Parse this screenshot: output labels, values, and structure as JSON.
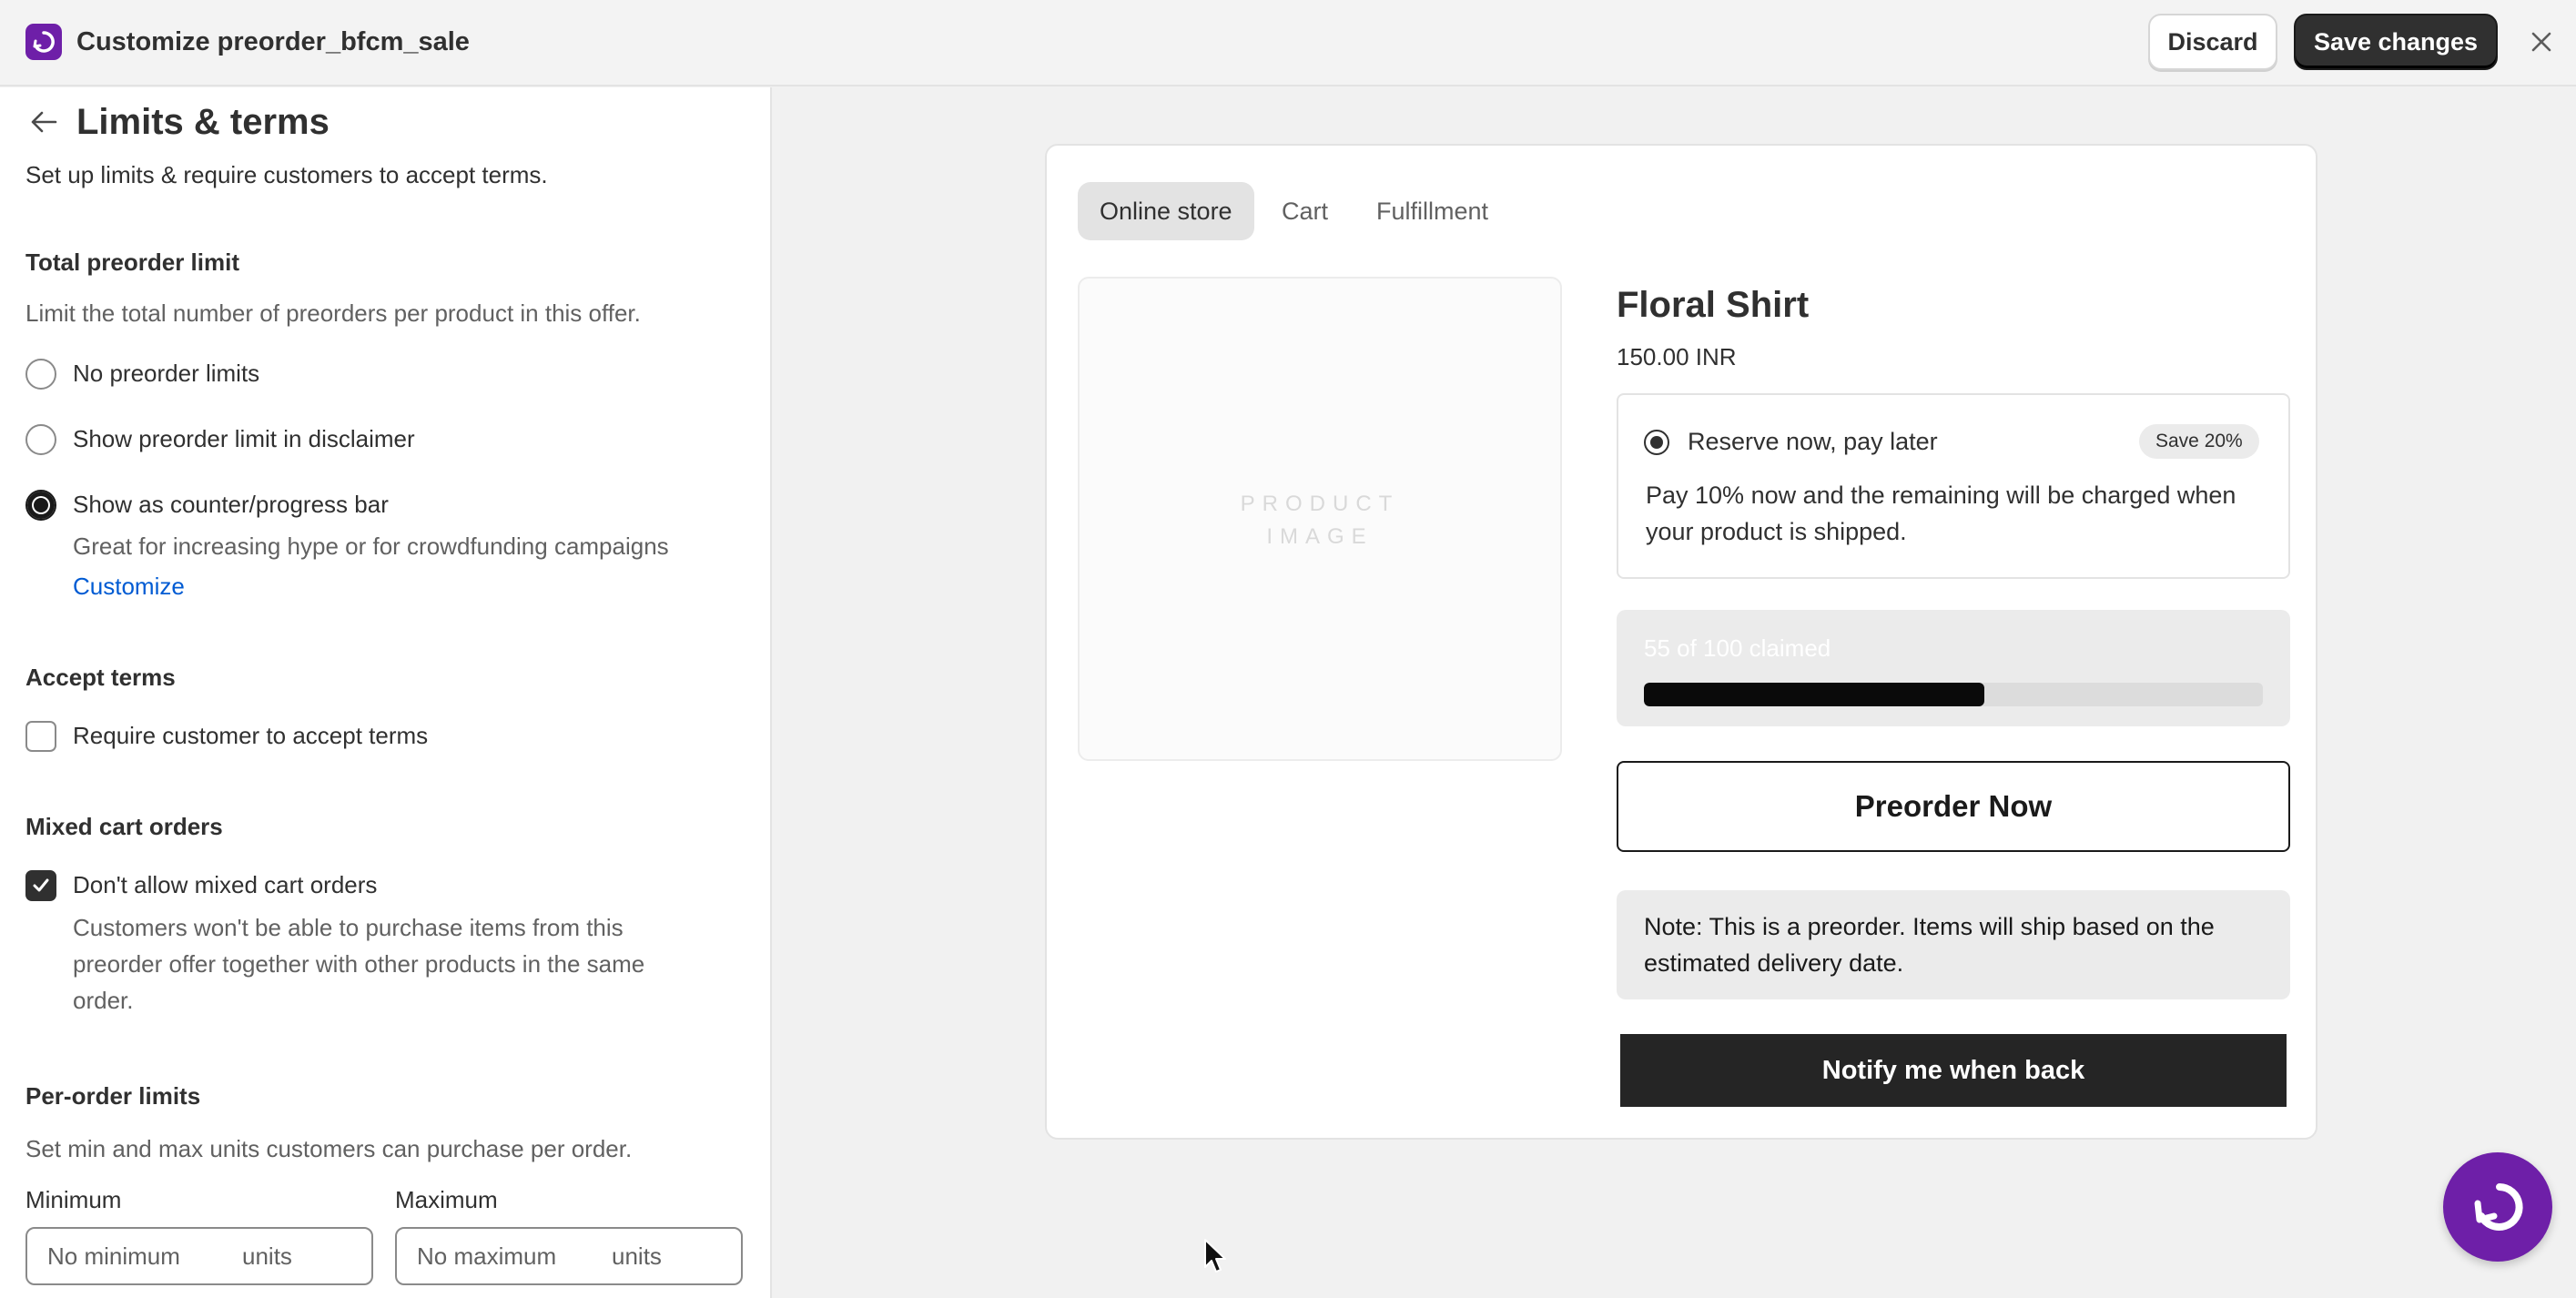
{
  "topbar": {
    "title": "Customize preorder_bfcm_sale",
    "discard_label": "Discard",
    "save_label": "Save changes",
    "logo_icon": "app-logo-icon",
    "close_icon": "close-icon"
  },
  "panel": {
    "title": "Limits & terms",
    "subtitle": "Set up limits & require customers to accept terms.",
    "total_limit": {
      "heading": "Total preorder limit",
      "description": "Limit the total number of preorders per product in this offer.",
      "options": [
        {
          "label": "No preorder limits",
          "selected": false
        },
        {
          "label": "Show preorder limit in disclaimer",
          "selected": false
        },
        {
          "label": "Show as counter/progress bar",
          "selected": true
        }
      ],
      "selected_help": "Great for increasing hype or for crowdfunding campaigns",
      "customize_link": "Customize"
    },
    "accept_terms": {
      "heading": "Accept terms",
      "checkbox_label": "Require customer to accept terms",
      "checked": false
    },
    "mixed_cart": {
      "heading": "Mixed cart orders",
      "checkbox_label": "Don't allow mixed cart orders",
      "checked": true,
      "help_line1": "Customers won't be able to purchase items from this",
      "help_line2": "preorder offer together with other products in the same",
      "help_line3": "order."
    },
    "per_order": {
      "heading": "Per-order limits",
      "description": "Set min and max units customers can purchase per order.",
      "min_label": "Minimum",
      "min_placeholder": "No minimum",
      "max_label": "Maximum",
      "max_placeholder": "No maximum",
      "unit_suffix": "units"
    }
  },
  "preview": {
    "tabs": [
      {
        "label": "Online store",
        "active": true
      },
      {
        "label": "Cart",
        "active": false
      },
      {
        "label": "Fulfillment",
        "active": false
      }
    ],
    "image_placeholder_line1": "PRODUCT",
    "image_placeholder_line2": "IMAGE",
    "product_title": "Floral Shirt",
    "price": "150.00 INR",
    "plan": {
      "label": "Reserve now, pay later",
      "badge": "Save 20%",
      "description": "Pay 10% now and the remaining will be charged when your product is shipped."
    },
    "progress": {
      "text": "55 of 100 claimed",
      "claimed": 55,
      "total": 100
    },
    "preorder_label": "Preorder Now",
    "note": "Note: This is a preorder. Items will ship based on the estimated delivery date.",
    "notify_label": "Notify me when back"
  },
  "colors": {
    "brand": "#6e1fa8",
    "primary_button": "#303030",
    "link": "#005bd3"
  }
}
